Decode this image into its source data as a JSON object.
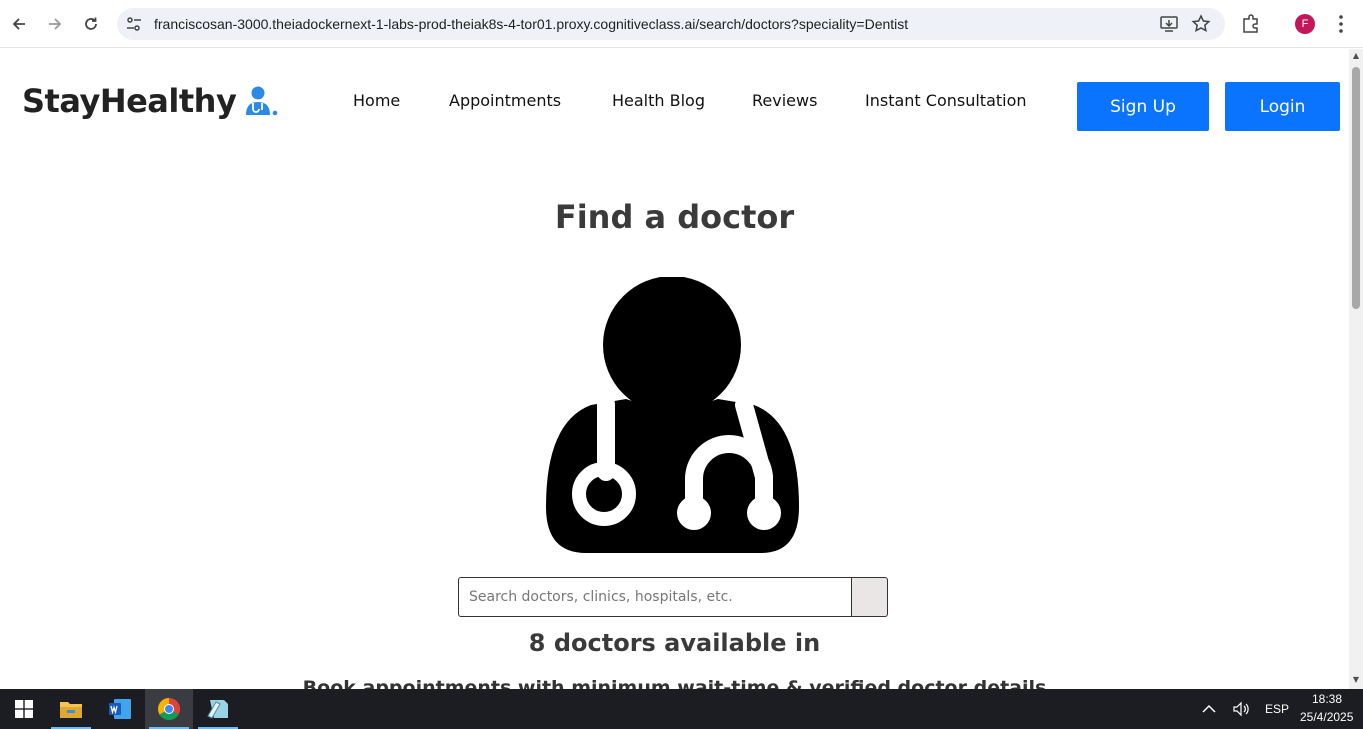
{
  "browser": {
    "url": "franciscosan-3000.theiadockernext-1-labs-prod-theiak8s-4-tor01.proxy.cognitiveclass.ai/search/doctors?speciality=Dentist",
    "profile_initial": "F"
  },
  "header": {
    "logo_text": "StayHealthy",
    "nav": [
      "Home",
      "Appointments",
      "Health Blog",
      "Reviews",
      "Instant Consultation"
    ],
    "signup_label": "Sign Up",
    "login_label": "Login"
  },
  "main": {
    "heading": "Find a doctor",
    "search_placeholder": "Search doctors, clinics, hospitals, etc.",
    "available_text": "8 doctors available in",
    "subtext": "Book appointments with minimum wait-time & verified doctor details"
  },
  "taskbar": {
    "language": "ESP",
    "time": "18:38",
    "date": "25/4/2025"
  },
  "colors": {
    "primary": "#0a74ff",
    "heading": "#3a3a3a",
    "taskbar": "#1c1d22"
  }
}
